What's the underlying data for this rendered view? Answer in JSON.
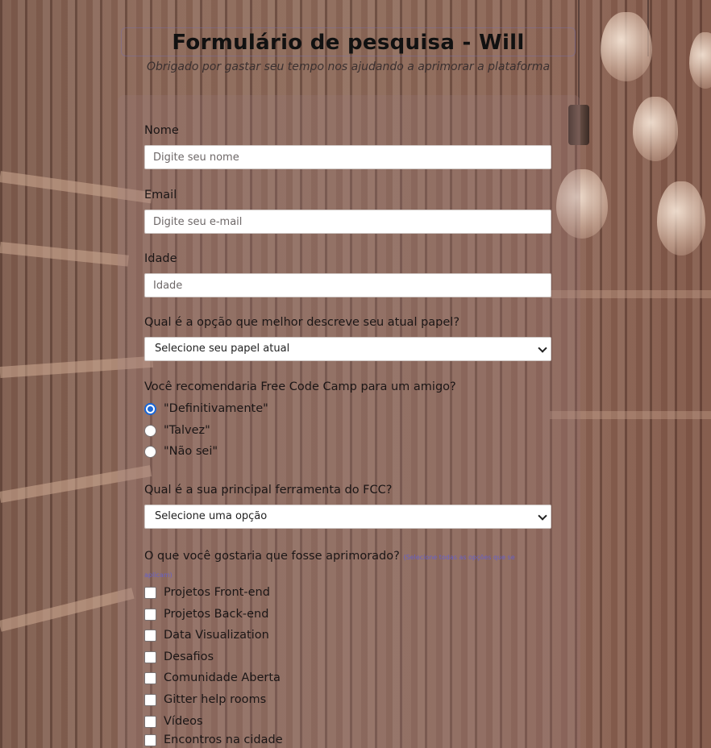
{
  "header": {
    "title": "Formulário de pesquisa - Will",
    "subtitle": "Obrigado por gastar seu tempo nos ajudando a aprimorar a plataforma"
  },
  "form": {
    "name": {
      "label": "Nome",
      "placeholder": "Digite seu nome"
    },
    "email": {
      "label": "Email",
      "placeholder": "Digite seu e-mail"
    },
    "age": {
      "label": "Idade",
      "placeholder": "Idade"
    },
    "role": {
      "label": "Qual é a opção que melhor descreve seu atual papel?",
      "selected": "Selecione seu papel atual"
    },
    "recommend": {
      "label": "Você recomendaria Free Code Camp para um amigo?",
      "options": [
        "\"Definitivamente\"",
        "\"Talvez\"",
        "\"Não sei\""
      ],
      "selected_index": 0
    },
    "tool": {
      "label": "Qual é a sua principal ferramenta do FCC?",
      "selected": "Selecione uma opção"
    },
    "improve": {
      "label": "O que você gostaria que fosse aprimorado?",
      "hint": "(Selecione todas as opções que se aplicam)",
      "options": [
        "Projetos Front-end",
        "Projetos Back-end",
        "Data Visualization",
        "Desafios",
        "Comunidade Aberta",
        "Gitter help rooms",
        "Vídeos",
        "Encontros na cidade"
      ]
    }
  },
  "colors": {
    "radio_accent": "#1a67d6",
    "hint": "#6660c8"
  }
}
